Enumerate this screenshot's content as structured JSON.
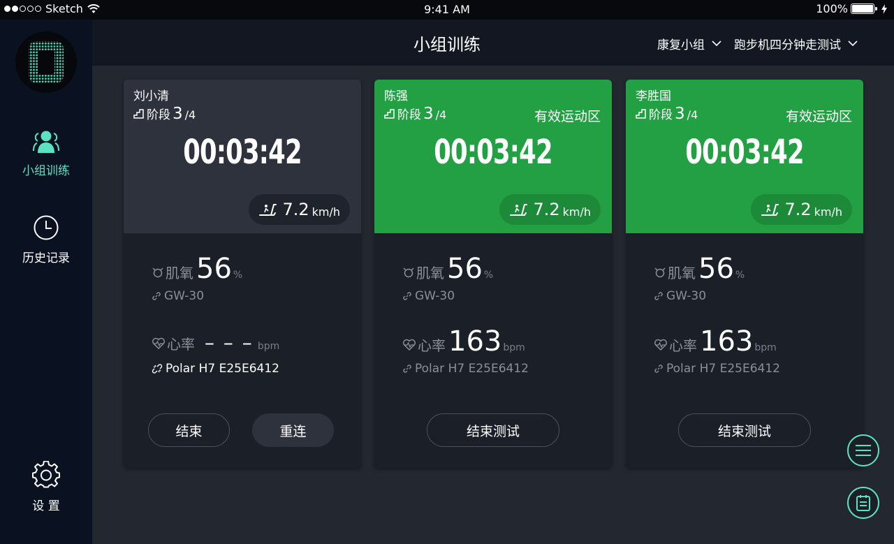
{
  "status_bar": {
    "carrier": "Sketch",
    "time": "9:41 AM",
    "battery": "100%"
  },
  "sidebar": {
    "items": [
      {
        "label": "小组训练",
        "icon": "group-icon",
        "active": true
      },
      {
        "label": "历史记录",
        "icon": "clock-icon"
      },
      {
        "label": "设 置",
        "icon": "gear-icon"
      }
    ]
  },
  "header": {
    "title": "小组训练",
    "group_select": "康复小组",
    "test_select": "跑步机四分钟走测试"
  },
  "cards": [
    {
      "name": "刘小清",
      "stage_label": "阶段",
      "stage_current": "3",
      "stage_total": "/4",
      "zone": "",
      "timer": "00:03:42",
      "speed": "7.2",
      "speed_unit": "km/h",
      "muscle_label": "肌氧",
      "muscle_value": "56",
      "muscle_unit": "%",
      "muscle_device": "GW-30",
      "hr_label": "心率",
      "hr_value": "– – –",
      "hr_unit": "bpm",
      "hr_device": "Polar H7 E25E6412",
      "btn_end": "结束",
      "btn_reconnect": "重连"
    },
    {
      "name": "陈强",
      "stage_label": "阶段",
      "stage_current": "3",
      "stage_total": "/4",
      "zone": "有效运动区",
      "timer": "00:03:42",
      "speed": "7.2",
      "speed_unit": "km/h",
      "muscle_label": "肌氧",
      "muscle_value": "56",
      "muscle_unit": "%",
      "muscle_device": "GW-30",
      "hr_label": "心率",
      "hr_value": "163",
      "hr_unit": "bpm",
      "hr_device": "Polar H7 E25E6412",
      "btn_end_test": "结束测试"
    },
    {
      "name": "李胜国",
      "stage_label": "阶段",
      "stage_current": "3",
      "stage_total": "/4",
      "zone": "有效运动区",
      "timer": "00:03:42",
      "speed": "7.2",
      "speed_unit": "km/h",
      "muscle_label": "肌氧",
      "muscle_value": "56",
      "muscle_unit": "%",
      "muscle_device": "GW-30",
      "hr_label": "心率",
      "hr_value": "163",
      "hr_unit": "bpm",
      "hr_device": "Polar H7 E25E6412",
      "btn_end_test": "结束测试"
    }
  ],
  "colors": {
    "accent": "#5ce2c1",
    "zone_green": "#24a044",
    "card_bg": "#1b1f28"
  }
}
